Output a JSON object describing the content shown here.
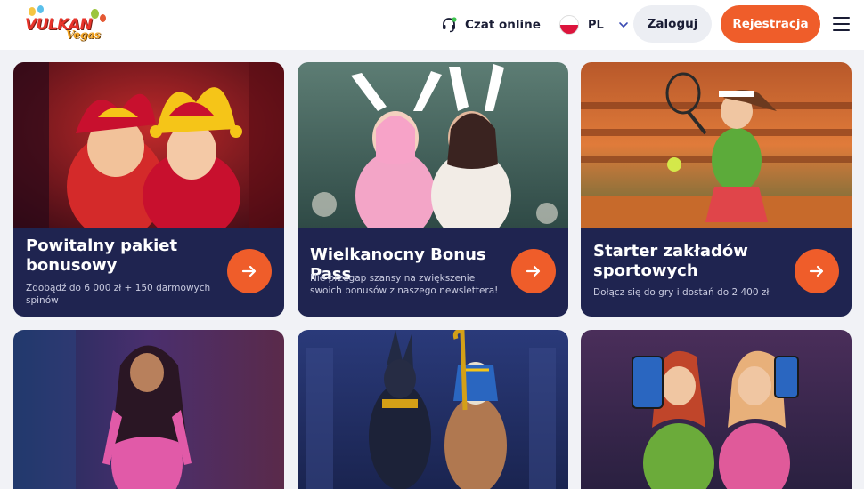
{
  "header": {
    "logo_text": "VULKAN",
    "logo_sub": "Vegas",
    "chat_label": "Czat online",
    "language": "PL",
    "login_label": "Zaloguj",
    "register_label": "Rejestracja"
  },
  "colors": {
    "accent": "#ef5d2a",
    "card_info_bg": "#1f2450",
    "page_bg": "#f1f2f6",
    "text_dark": "#1a1d35"
  },
  "icons": {
    "chat": "headset-chat-icon",
    "flag": "poland-flag-icon",
    "chevron": "chevron-down-icon",
    "menu": "hamburger-menu-icon",
    "arrow": "arrow-right-icon"
  },
  "promotions": [
    {
      "title": "Powitalny pakiet bonusowy",
      "description": "Zdobądź do 6 000 zł + 150 darmowych spinów"
    },
    {
      "title": "Wielkanocny Bonus Pass",
      "description": "Nie przegap szansy na zwiększenie swoich bonusów z naszego newslettera!"
    },
    {
      "title": "Starter zakładów sportowych",
      "description": "Dołącz się do gry i dostań do 2 400 zł"
    }
  ]
}
